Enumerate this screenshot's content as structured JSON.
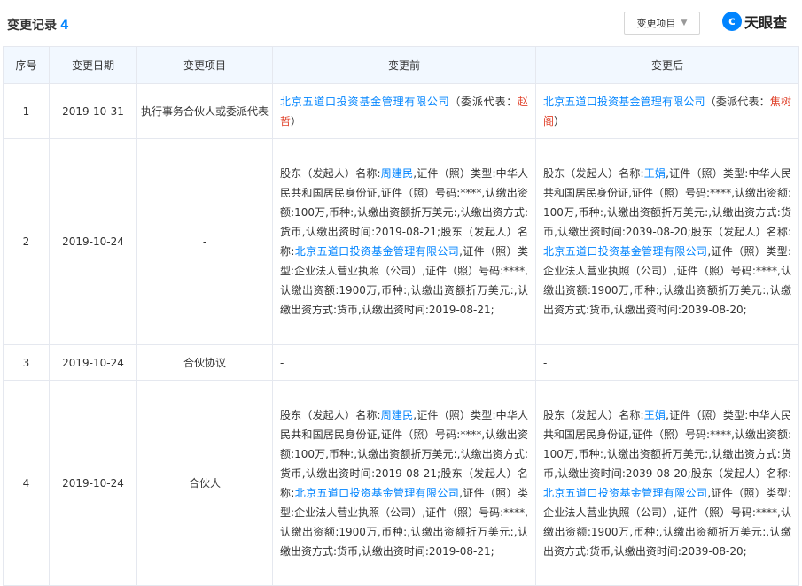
{
  "header": {
    "title": "变更记录",
    "count": "4",
    "filter_label": "变更项目",
    "logo_text": "天眼查"
  },
  "table": {
    "columns": [
      "序号",
      "变更日期",
      "变更项目",
      "变更前",
      "变更后"
    ],
    "rows": [
      {
        "no": "1",
        "date": "2019-10-31",
        "item": "执行事务合伙人或委派代表",
        "before": {
          "company": "北京五道口投资基金管理有限公司",
          "mid": "（委派代表：",
          "rep": "赵哲",
          "tail": "）"
        },
        "after": {
          "company": "北京五道口投资基金管理有限公司",
          "mid": "（委派代表：",
          "rep": "焦树阁",
          "tail": "）"
        }
      },
      {
        "no": "2",
        "date": "2019-10-24",
        "item": "-",
        "before": {
          "p1": "股东（发起人）名称:",
          "name": "周建民",
          "p2": ",证件（照）类型:中华人民共和国居民身份证,证件（照）号码:****,认缴出资额:100万,币种:,认缴出资额折万美元:,认缴出资方式:货币,认缴出资时间:2019-08-21;股东（发起人）名称:",
          "company": "北京五道口投资基金管理有限公司",
          "p3": ",证件（照）类型:企业法人营业执照（公司）,证件（照）号码:****,认缴出资额:1900万,币种:,认缴出资额折万美元:,认缴出资方式:货币,认缴出资时间:2019-08-21;"
        },
        "after": {
          "p1": "股东（发起人）名称:",
          "name": "王娟",
          "p2": ",证件（照）类型:中华人民共和国居民身份证,证件（照）号码:****,认缴出资额:100万,币种:,认缴出资额折万美元:,认缴出资方式:货币,认缴出资时间:2039-08-20;股东（发起人）名称:",
          "company": "北京五道口投资基金管理有限公司",
          "p3": ",证件（照）类型:企业法人营业执照（公司）,证件（照）号码:****,认缴出资额:1900万,币种:,认缴出资额折万美元:,认缴出资方式:货币,认缴出资时间:2039-08-20;"
        }
      },
      {
        "no": "3",
        "date": "2019-10-24",
        "item": "合伙协议",
        "before_text": "-",
        "after_text": "-"
      },
      {
        "no": "4",
        "date": "2019-10-24",
        "item": "合伙人",
        "before": {
          "p1": "股东（发起人）名称:",
          "name": "周建民",
          "p2": ",证件（照）类型:中华人民共和国居民身份证,证件（照）号码:****,认缴出资额:100万,币种:,认缴出资额折万美元:,认缴出资方式:货币,认缴出资时间:2019-08-21;股东（发起人）名称:",
          "company": "北京五道口投资基金管理有限公司",
          "p3": ",证件（照）类型:企业法人营业执照（公司）,证件（照）号码:****,认缴出资额:1900万,币种:,认缴出资额折万美元:,认缴出资方式:货币,认缴出资时间:2019-08-21;"
        },
        "after": {
          "p1": "股东（发起人）名称:",
          "name": "王娟",
          "p2": ",证件（照）类型:中华人民共和国居民身份证,证件（照）号码:****,认缴出资额:100万,币种:,认缴出资额折万美元:,认缴出资方式:货币,认缴出资时间:2039-08-20;股东（发起人）名称:",
          "company": "北京五道口投资基金管理有限公司",
          "p3": ",证件（照）类型:企业法人营业执照（公司）,证件（照）号码:****,认缴出资额:1900万,币种:,认缴出资额折万美元:,认缴出资方式:货币,认缴出资时间:2039-08-20;"
        }
      }
    ]
  },
  "colors": {
    "accent": "#0084ff",
    "highlight": "#e0432c",
    "header_bg": "#f2f8ff",
    "border": "#e5e8ef"
  },
  "icons": {
    "filter_caret": "caret-down-icon",
    "logo": "tianyancha-logo-icon"
  }
}
